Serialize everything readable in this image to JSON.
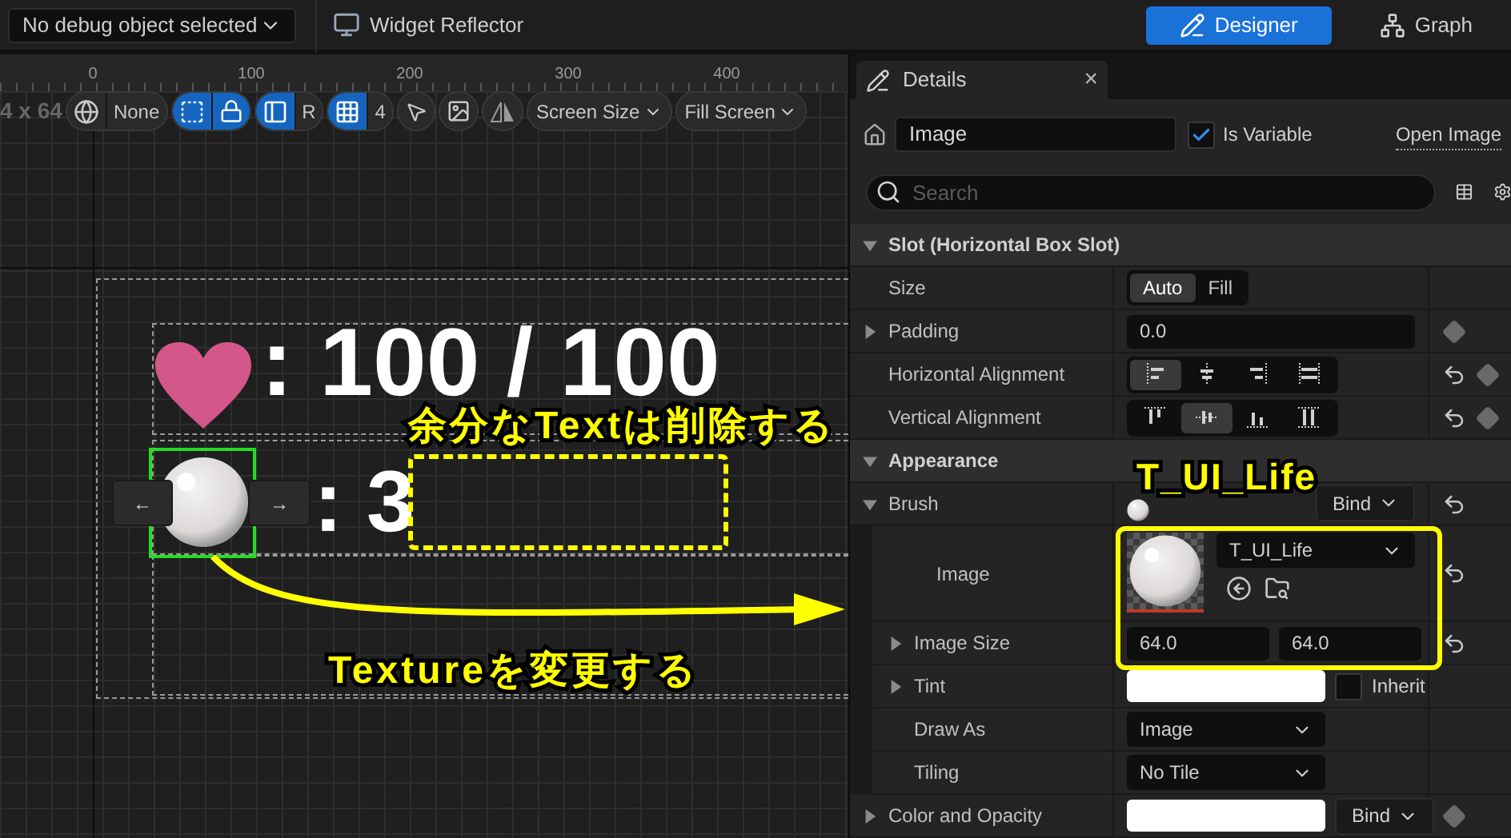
{
  "top_bar": {
    "debug_dropdown": "No debug object selected",
    "widget_reflector": "Widget Reflector",
    "modes": [
      {
        "label": "Designer",
        "selected": true
      },
      {
        "label": "Graph",
        "selected": false
      }
    ]
  },
  "canvas": {
    "ruler_ticks": [
      "0",
      "100",
      "200",
      "300",
      "400"
    ],
    "size_label": "4 x 64",
    "toolbar": [
      [
        {
          "kind": "globe"
        },
        {
          "kind": "text",
          "label": "None"
        }
      ],
      [
        {
          "kind": "marquee",
          "on": true
        },
        {
          "kind": "lock",
          "on": true
        }
      ],
      [
        {
          "kind": "layout",
          "on": true
        },
        {
          "kind": "text",
          "label": "R"
        }
      ],
      [
        {
          "kind": "grid",
          "on": true
        },
        {
          "kind": "text",
          "label": "4"
        }
      ],
      [
        {
          "kind": "cursor"
        }
      ],
      [
        {
          "kind": "image"
        }
      ],
      [
        {
          "kind": "flip"
        }
      ],
      [
        {
          "kind": "dropdown",
          "label": "Screen Size"
        }
      ],
      [
        {
          "kind": "dropdown",
          "label": "Fill Screen"
        }
      ]
    ],
    "hp_text": ": 100 / 100",
    "count_text": ": 3",
    "nudge_buttons": [
      "←",
      "→"
    ]
  },
  "annotations": {
    "delete_note": "余分なTextは削除する",
    "texture_note": "Textureを変更する",
    "asset_note": "T_UI_Life"
  },
  "details": {
    "title": "Details",
    "close": "×",
    "name_field": "Image",
    "is_variable": {
      "label": "Is Variable",
      "checked": true
    },
    "open_link": "Open Image",
    "search_placeholder": "Search",
    "sections": [
      {
        "title": "Slot (Horizontal Box Slot)",
        "expanded": true,
        "rows": [
          {
            "kind": "segmented",
            "label": "Size",
            "modified": false,
            "bindable": false,
            "options": [
              {
                "label": "Auto",
                "selected": true
              },
              {
                "label": "Fill",
                "selected": false
              }
            ]
          },
          {
            "kind": "text",
            "label": "Padding",
            "expanded": false,
            "modified": false,
            "bindable": true,
            "value": "0.0"
          },
          {
            "kind": "align",
            "label": "Horizontal Alignment",
            "modified": true,
            "bindable": true,
            "options": [
              {
                "kind": "left",
                "selected": true
              },
              {
                "kind": "center_h",
                "selected": false
              },
              {
                "kind": "right",
                "selected": false
              },
              {
                "kind": "fill_h",
                "selected": false
              }
            ]
          },
          {
            "kind": "align",
            "label": "Vertical Alignment",
            "modified": true,
            "bindable": true,
            "options": [
              {
                "kind": "top",
                "selected": false
              },
              {
                "kind": "center_v",
                "selected": true
              },
              {
                "kind": "bottom",
                "selected": false
              },
              {
                "kind": "fill_v",
                "selected": false
              }
            ]
          }
        ]
      },
      {
        "title": "Appearance",
        "expanded": true,
        "rows": [
          {
            "kind": "brush",
            "label": "Brush",
            "expanded": true,
            "modified": true,
            "bindable": false,
            "bind": "Bind",
            "children": [
              {
                "kind": "image",
                "label": "Image",
                "modified": true,
                "bindable": false,
                "asset": "T_UI_Life"
              },
              {
                "kind": "vector",
                "label": "Image Size",
                "expanded": false,
                "modified": true,
                "bindable": false,
                "values": [
                  "64.0",
                  "64.0"
                ]
              },
              {
                "kind": "color",
                "label": "Tint",
                "expanded": false,
                "modified": false,
                "bindable": false,
                "inherit": {
                  "label": "Inherit",
                  "checked": false
                }
              },
              {
                "kind": "dropdown",
                "label": "Draw As",
                "modified": false,
                "bindable": false,
                "value": "Image"
              },
              {
                "kind": "dropdown",
                "label": "Tiling",
                "modified": false,
                "bindable": false,
                "value": "No Tile"
              }
            ]
          },
          {
            "kind": "color_bind",
            "label": "Color and Opacity",
            "expanded": false,
            "modified": false,
            "bindable": true,
            "bind": "Bind"
          }
        ]
      }
    ]
  }
}
